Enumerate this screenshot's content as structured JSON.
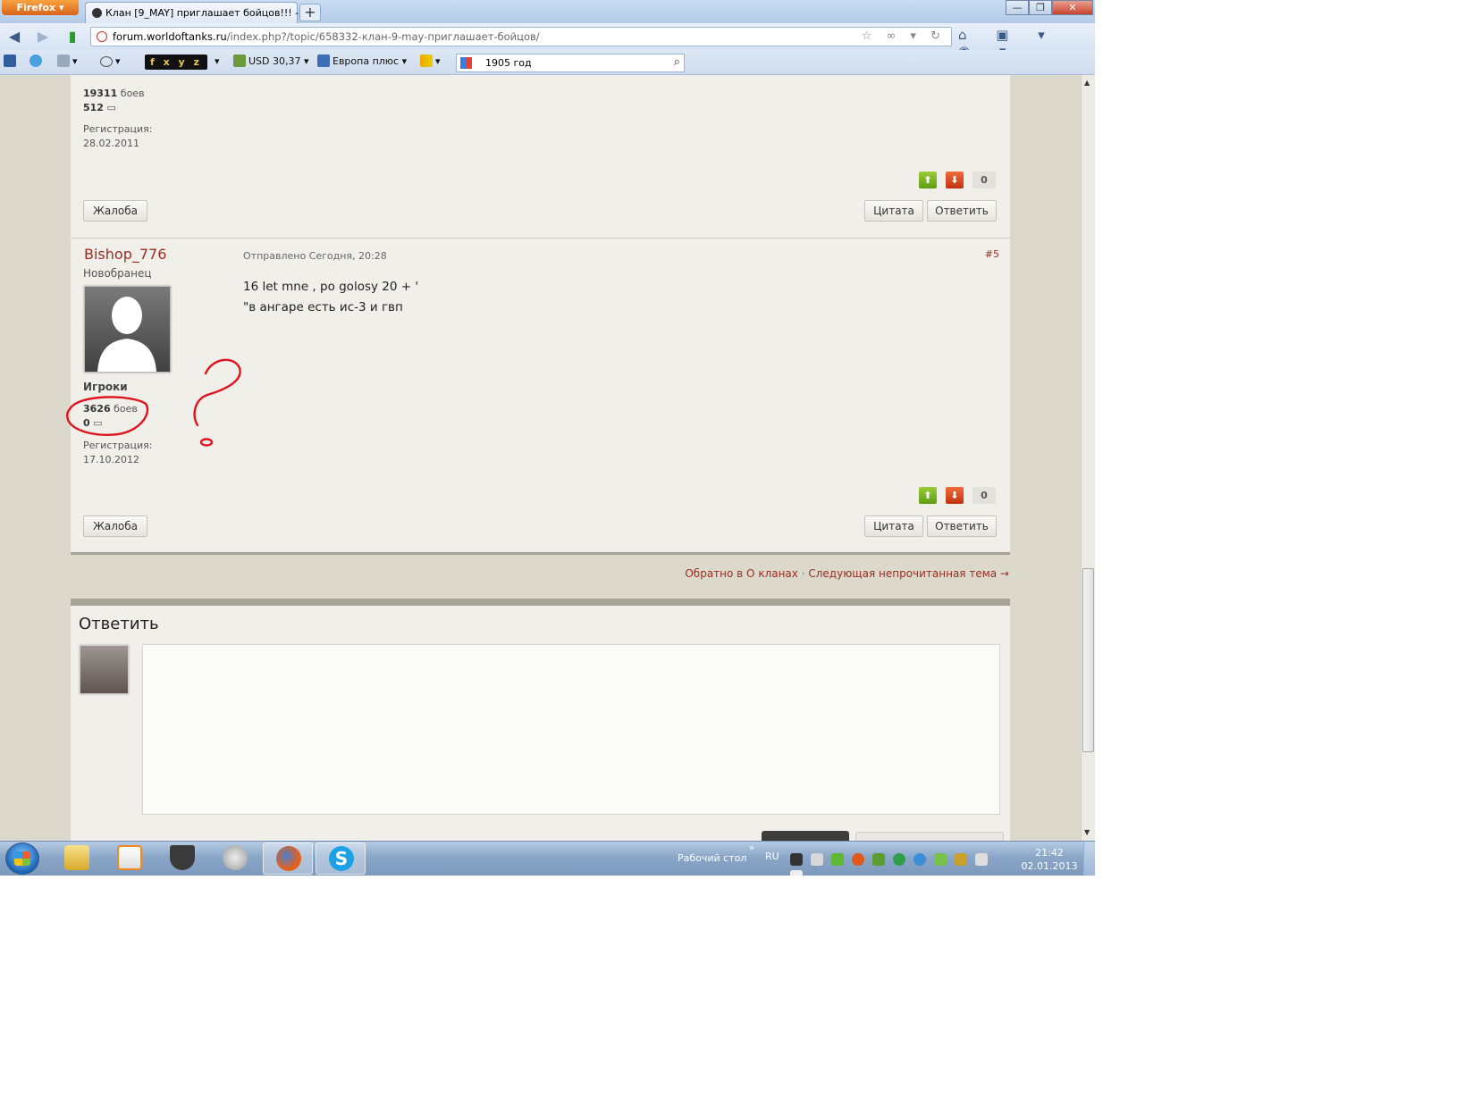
{
  "browser": {
    "menu_label": "Firefox",
    "tab_title": "Клан [9_MAY] приглашает бойцов!!! - ...",
    "new_tab": "+",
    "url_domain": "forum.worldoftanks.ru",
    "url_path": "/index.php?/topic/658332-клан-9-may-приглашает-бойцов/",
    "win_min": "—",
    "win_max": "❐",
    "win_close": "✕"
  },
  "bookmarks": {
    "fxyz": "f x y z",
    "usd": "USD 30,37",
    "radio": "Европа плюс",
    "search_value": "1905 год"
  },
  "posts": [
    {
      "battles": "19311",
      "battles_label": "боев",
      "posts_count": "512",
      "reg_label": "Регистрация:",
      "reg_date": "28.02.2011",
      "vote_count": "0",
      "complain": "Жалоба",
      "quote": "Цитата",
      "reply": "Ответить"
    },
    {
      "author": "Bishop_776",
      "rank": "Новобранец",
      "group": "Игроки",
      "battles": "3626",
      "battles_label": "боев",
      "posts_count": "0",
      "reg_label": "Регистрация:",
      "reg_date": "17.10.2012",
      "meta": "Отправлено Сегодня, 20:28",
      "number": "#5",
      "body_line1": "16  let mne , po golosy 20 + '",
      "body_line2": "\"в ангаре есть ис-3 и гвп",
      "vote_count": "0",
      "complain": "Жалоба",
      "quote": "Цитата",
      "reply": "Ответить"
    }
  ],
  "nav_links": {
    "back": "Обратно в О кланах",
    "separator": "·",
    "next": "Следующая непрочитанная тема →"
  },
  "reply_box": {
    "title": "Ответить"
  },
  "taskbar": {
    "desktop_label": "Рабочий стол",
    "lang": "RU",
    "time": "21:42",
    "date": "02.01.2013"
  },
  "colors": {
    "link": "#9a2d22",
    "vote_up": "#5d9c12",
    "vote_down": "#c33212",
    "annotation": "#e0141e"
  }
}
